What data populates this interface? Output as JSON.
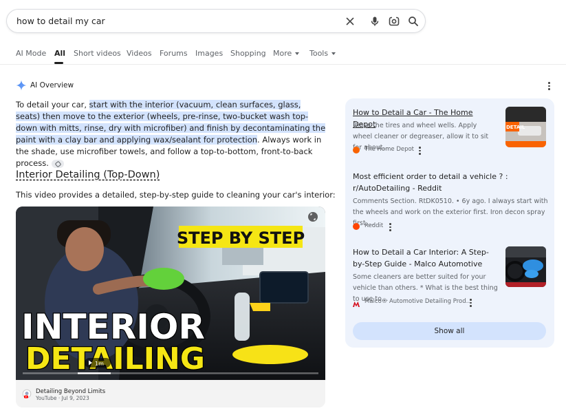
{
  "search": {
    "query": "how to detail my car"
  },
  "tabs": [
    {
      "label": "AI Mode"
    },
    {
      "label": "All"
    },
    {
      "label": "Short videos"
    },
    {
      "label": "Videos"
    },
    {
      "label": "Forums"
    },
    {
      "label": "Images"
    },
    {
      "label": "Shopping"
    },
    {
      "label": "More"
    },
    {
      "label": "Tools"
    }
  ],
  "ai_overview": {
    "label": "AI Overview",
    "summary_intro": "To detail your car, ",
    "summary_highlight": "start with the interior (vacuum, clean surfaces, glass, seats) then move to the exterior (wheels, pre-rinse, two-bucket wash top-down with mitts, rinse, dry with microfiber) and finish by decontaminating the paint with a clay bar and applying wax/sealant for protection",
    "summary_rest": ". Always work in the shade, use microfiber towels, and follow a top-to-bottom, front-to-back process.",
    "section_heading": "Interior Detailing (Top-Down)",
    "video_intro": "This video provides a detailed, step-by-step guide to cleaning your car's interior:"
  },
  "video": {
    "overlay_top": "STEP BY STEP",
    "overlay_line1": "INTERIOR",
    "overlay_line2": "DETAILING",
    "duration": "1m",
    "channel": "Detailing Beyond Limits",
    "platform_date": "YouTube · Jul 9, 2023"
  },
  "sources": [
    {
      "title": "How to Detail a Car - The Home Depot",
      "snippet": "Rinse the tires and wheel wells. Apply wheel cleaner or degreaser, allow it to sit for about…",
      "site": "The Home Depot",
      "thumb_text": "DETAIL"
    },
    {
      "title": "Most efficient order to detail a vehicle ? : r/AutoDetailing - Reddit",
      "snippet": "Comments Section. RtDK0510. • 6y ago. I always start with the wheels and work on the exterior first. Iron decon spray first,…",
      "site": "Reddit"
    },
    {
      "title": "How to Detail a Car Interior: A Step-by-Step Guide - Malco Automotive",
      "snippet": "Some cleaners are better suited for your vehicle than others. * What is the best thing to use to…",
      "site": "Malco® Automotive Detailing Prod…"
    }
  ],
  "show_all": "Show all",
  "colors": {
    "highlight": "#d3e3fd",
    "sources_bg": "#eef3fc",
    "overlay_yellow": "#f5e614",
    "home_depot": "#f96302",
    "reddit": "#ff4500",
    "malco": "#d40f1e"
  },
  "icons": [
    "close-icon",
    "mic-icon",
    "lens-icon",
    "search-icon",
    "ai-sparkle-icon",
    "link-icon",
    "play-icon",
    "fullscreen-icon",
    "youtube-icon"
  ]
}
